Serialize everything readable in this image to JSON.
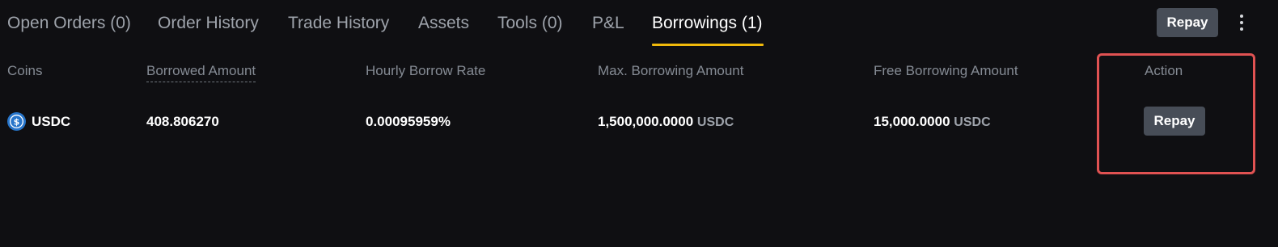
{
  "tabs": [
    {
      "label": "Open Orders (0)"
    },
    {
      "label": "Order History"
    },
    {
      "label": "Trade History"
    },
    {
      "label": "Assets"
    },
    {
      "label": "Tools (0)"
    },
    {
      "label": "P&L"
    },
    {
      "label": "Borrowings (1)",
      "active": true
    }
  ],
  "toolbar": {
    "repay_label": "Repay",
    "more_icon": "more-vertical-icon"
  },
  "table": {
    "headers": {
      "coins": "Coins",
      "borrowed_amount": "Borrowed Amount",
      "hourly_rate": "Hourly Borrow Rate",
      "max_borrowing": "Max. Borrowing Amount",
      "free_borrowing": "Free Borrowing Amount",
      "action": "Action"
    },
    "rows": [
      {
        "coin": "USDC",
        "coin_icon": "usdc-icon",
        "borrowed_amount": "408.806270",
        "hourly_rate": "0.00095959%",
        "max_borrowing_value": "1,500,000.0000",
        "max_borrowing_unit": "USDC",
        "free_borrowing_value": "15,000.0000",
        "free_borrowing_unit": "USDC",
        "action_label": "Repay"
      }
    ]
  },
  "colors": {
    "background": "#0f0f12",
    "active_tab_underline": "#f0b90b",
    "button_bg": "#474d57",
    "highlight_border": "#e05252",
    "usdc_blue": "#2775ca"
  }
}
